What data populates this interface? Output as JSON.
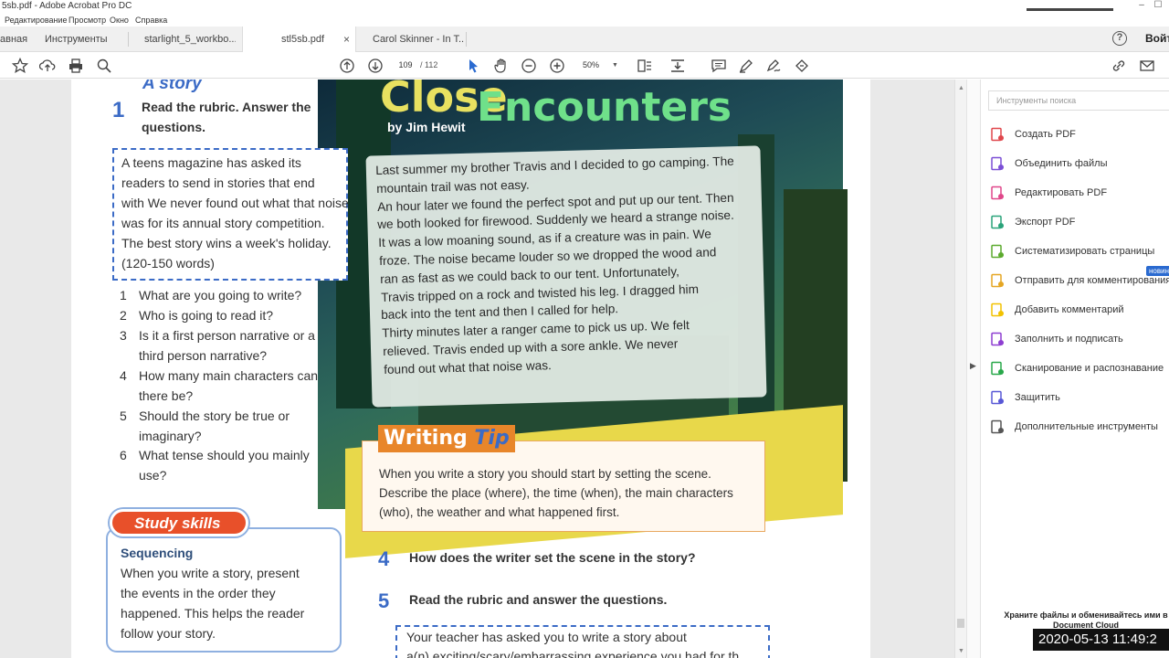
{
  "window": {
    "title": "5sb.pdf - Adobe Acrobat Pro DC"
  },
  "menu": [
    "Редактирование",
    "Просмотр",
    "Окно",
    "Справка"
  ],
  "tabs": {
    "home": "авная",
    "tools": "Инструменты",
    "doc1": "starlight_5_workbo...",
    "doc2": "stl5sb.pdf",
    "doc3": "Carol Skinner - In T..."
  },
  "header": {
    "help": "?",
    "login": "Войт"
  },
  "toolbar": {
    "page_current": "109",
    "page_total": "/ 112",
    "zoom": "50%"
  },
  "page": {
    "heading_partial": "A story",
    "title": "Close",
    "title2": "Encounters",
    "byline": "by Jim Hewit",
    "task1_num": "1",
    "task1_text": [
      "Read the rubric. Answer the",
      "questions."
    ],
    "rubric": [
      "A teens magazine has asked its",
      "readers to send in stories that end",
      "with We never found out what that noise",
      "was for its annual story competition.",
      "The best story wins a week's holiday.",
      "(120-150 words)"
    ],
    "questions": [
      {
        "n": "1",
        "lines": [
          "What are you going to write?"
        ]
      },
      {
        "n": "2",
        "lines": [
          "Who is going to read it?"
        ]
      },
      {
        "n": "3",
        "lines": [
          "Is it a first person narrative or a",
          "third person narrative?"
        ]
      },
      {
        "n": "4",
        "lines": [
          "How many main characters can",
          "there be?"
        ]
      },
      {
        "n": "5",
        "lines": [
          "Should the story be true or",
          "imaginary?"
        ]
      },
      {
        "n": "6",
        "lines": [
          "What tense should you mainly",
          "use?"
        ]
      }
    ],
    "story": [
      "Last summer my brother Travis and I decided to go camping. The",
      "mountain trail was not easy.",
      "An hour later we found the perfect spot and put up our tent. Then",
      "we both looked for firewood. Suddenly we heard a strange noise.",
      "It was a low moaning sound, as if a creature was in pain. We",
      "froze. The noise became louder so we dropped the wood and",
      "ran as fast as we could back to our tent. Unfortunately,",
      "Travis tripped on a rock and twisted his leg. I dragged him",
      "back into the tent and then I called for help.",
      "Thirty minutes later a ranger came to pick us up. We felt",
      "relieved. Travis ended up with a sore ankle. We never",
      "found out what that noise was."
    ],
    "tip_title_a": "Writing",
    "tip_title_b": "Tip",
    "tip": [
      "When you write a story you should start by setting the scene.",
      "Describe the place (where), the time (when), the main characters",
      "(who), the weather and what happened first."
    ],
    "study_title": "Study skills",
    "study_heading": "Sequencing",
    "study": [
      "When you write a story, present",
      "the events in the order they",
      "happened. This helps the reader",
      "follow your story."
    ],
    "task4_num": "4",
    "task4_text": "How does the writer set the scene in the story?",
    "task5_num": "5",
    "task5_text": "Read the rubric and answer the questions.",
    "rubric2": [
      "Your teacher has asked you to write a story about",
      "a(n) exciting/scary/embarrassing experience you had for th"
    ]
  },
  "right_panel": {
    "search_placeholder": "Инструменты поиска",
    "tools": [
      {
        "label": "Создать PDF",
        "icon": "create-pdf-icon",
        "color": "#e0474c"
      },
      {
        "label": "Объединить файлы",
        "icon": "combine-files-icon",
        "color": "#7b4fd6"
      },
      {
        "label": "Редактировать PDF",
        "icon": "edit-pdf-icon",
        "color": "#e0478a"
      },
      {
        "label": "Экспорт PDF",
        "icon": "export-pdf-icon",
        "color": "#2aa37a"
      },
      {
        "label": "Систематизировать страницы",
        "icon": "organize-pages-icon",
        "color": "#5caa2e"
      },
      {
        "label": "Отправить для комментирования",
        "icon": "send-comment-icon",
        "color": "#e5a623"
      },
      {
        "label": "Добавить комментарий",
        "icon": "comment-icon",
        "color": "#f2c200"
      },
      {
        "label": "Заполнить и подписать",
        "icon": "fill-sign-icon",
        "color": "#8e3fd1"
      },
      {
        "label": "Сканирование и распознавание",
        "icon": "scan-icon",
        "color": "#29a84a"
      },
      {
        "label": "Защитить",
        "icon": "protect-icon",
        "color": "#5858d6"
      },
      {
        "label": "Дополнительные инструменты",
        "icon": "more-tools-icon",
        "color": "#555555"
      }
    ],
    "new_badge": "новин",
    "cloud_text": [
      "Храните файлы и обменивайтесь ими в",
      "Document Cloud"
    ]
  },
  "overlay": {
    "timestamp": "2020-05-13  11:49:2"
  }
}
